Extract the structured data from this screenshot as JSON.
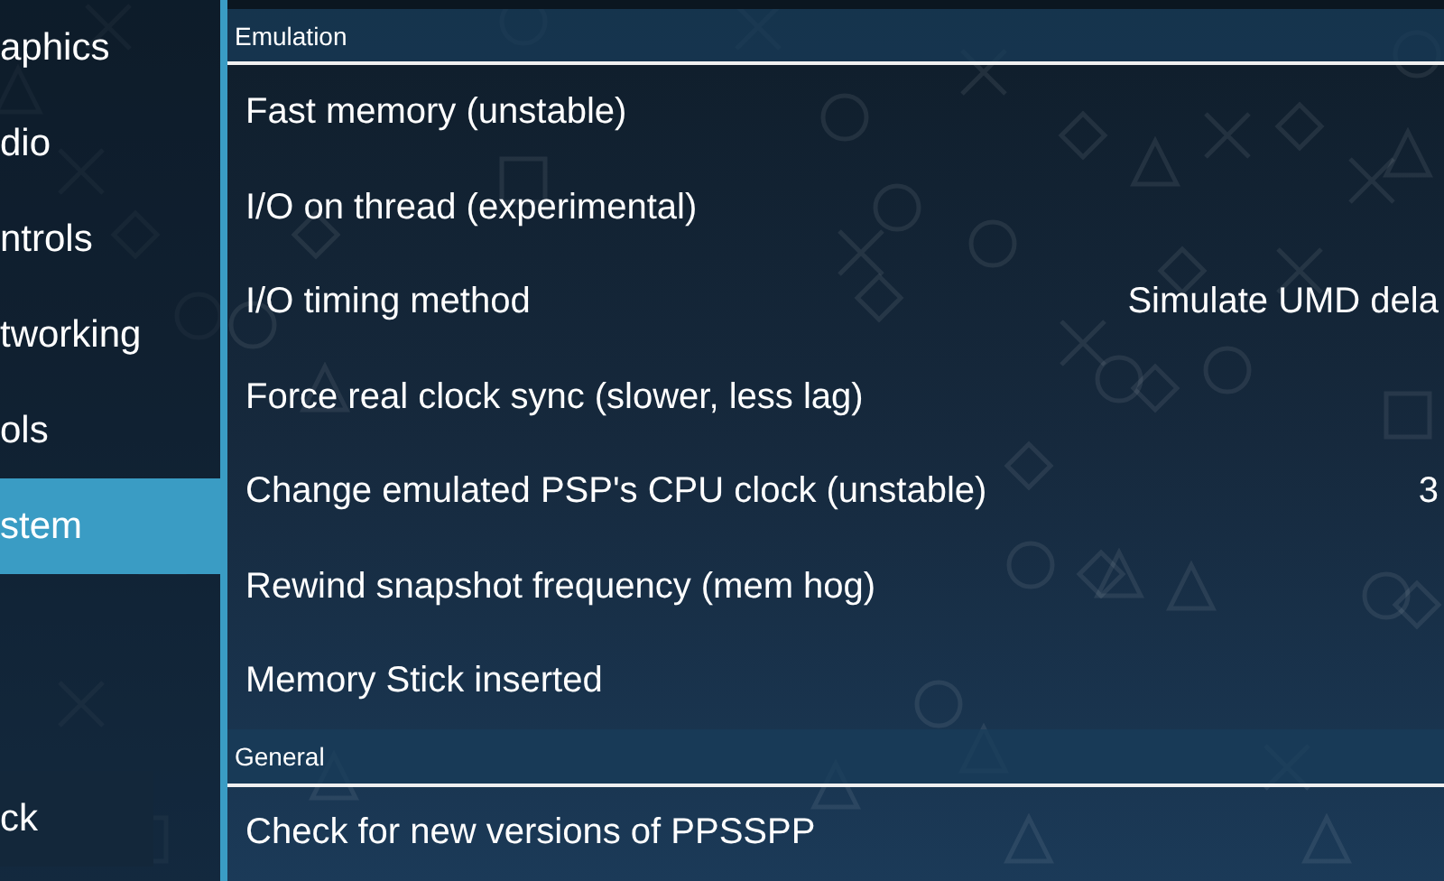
{
  "sidebar": {
    "items": [
      {
        "label": "aphics",
        "selected": false
      },
      {
        "label": "dio",
        "selected": false
      },
      {
        "label": "ntrols",
        "selected": false
      },
      {
        "label": "tworking",
        "selected": false
      },
      {
        "label": "ols",
        "selected": false
      },
      {
        "label": "stem",
        "selected": true
      }
    ],
    "back_button": "ck"
  },
  "sections": [
    {
      "title": "Emulation",
      "rows": [
        {
          "label": "Fast memory (unstable)"
        },
        {
          "label": "I/O on thread (experimental)"
        },
        {
          "label": "I/O timing method",
          "value": "Simulate UMD dela"
        },
        {
          "label": "Force real clock sync (slower, less lag)"
        },
        {
          "label": "Change emulated PSP's CPU clock (unstable)",
          "value": "3"
        },
        {
          "label": "Rewind snapshot frequency (mem hog)"
        },
        {
          "label": "Memory Stick inserted"
        }
      ]
    },
    {
      "title": "General",
      "rows": [
        {
          "label": "Check for new versions of PPSSPP"
        }
      ]
    }
  ]
}
